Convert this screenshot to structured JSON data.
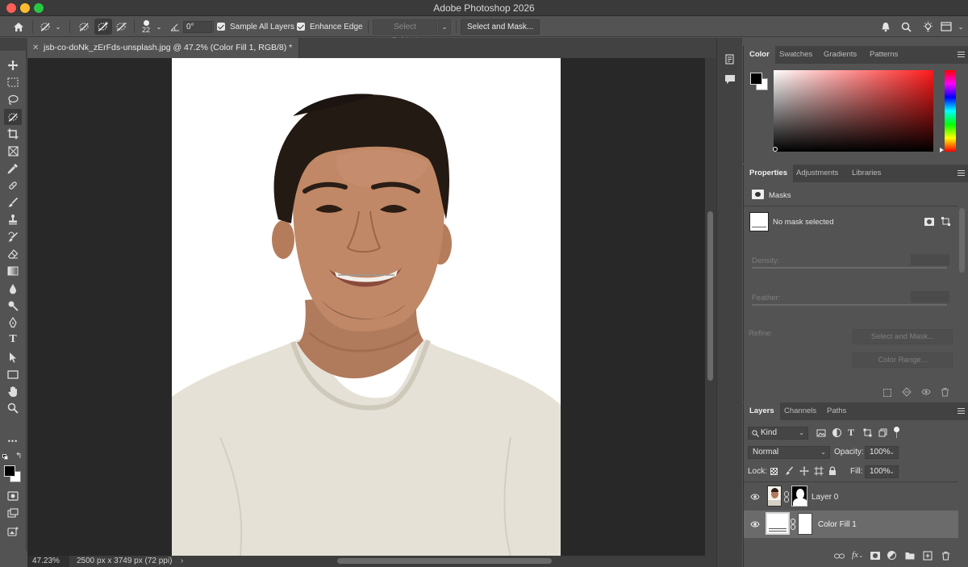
{
  "app": {
    "title": "Adobe Photoshop 2026"
  },
  "options_bar": {
    "brush_size": "22",
    "angle": "0°",
    "sample_all_layers": "Sample All Layers",
    "enhance_edge": "Enhance Edge",
    "select_subject": "Select Subject",
    "select_and_mask": "Select and Mask..."
  },
  "document": {
    "tab_title": "jsb-co-doNk_zErFds-unsplash.jpg @ 47.2% (Color Fill 1, RGB/8) *"
  },
  "status": {
    "zoom": "47.23%",
    "doc_info": "2500 px x 3749 px (72 ppi)",
    "arrow": "›"
  },
  "toolbar": {
    "type_tool_glyph": "T",
    "more_tools": "•••"
  },
  "color_panel": {
    "tabs": [
      "Color",
      "Swatches",
      "Gradients",
      "Patterns"
    ],
    "hue_color": "#ff1a1a",
    "foreground": "#000000",
    "background": "#ffffff"
  },
  "properties_panel": {
    "tabs": [
      "Properties",
      "Adjustments",
      "Libraries"
    ],
    "section": "Masks",
    "no_mask": "No mask selected",
    "density_label": "Density:",
    "feather_label": "Feather:",
    "refine_label": "Refine:",
    "select_and_mask_btn": "Select and Mask...",
    "color_range_btn": "Color Range..."
  },
  "layers_panel": {
    "tabs": [
      "Layers",
      "Channels",
      "Paths"
    ],
    "filter_kind": "Kind",
    "blend_mode": "Normal",
    "opacity_label": "Opacity:",
    "opacity_value": "100%",
    "lock_label": "Lock:",
    "fill_label": "Fill:",
    "fill_value": "100%",
    "layers": [
      {
        "name": "Layer 0",
        "selected": false
      },
      {
        "name": "Color Fill 1",
        "selected": true
      }
    ]
  }
}
